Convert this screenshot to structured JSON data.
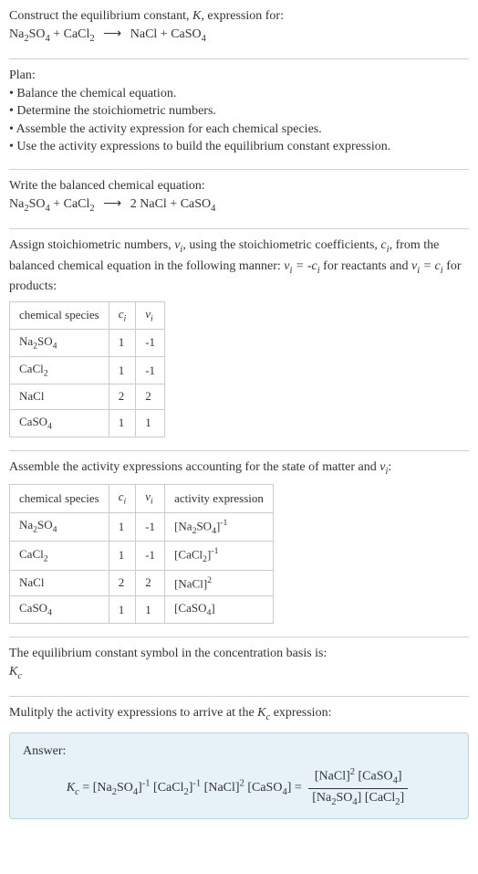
{
  "prompt": {
    "line1_pre": "Construct the equilibrium constant, ",
    "line1_post": ", expression for:"
  },
  "plan": {
    "heading": "Plan:",
    "items": [
      "Balance the chemical equation.",
      "Determine the stoichiometric numbers.",
      "Assemble the activity expression for each chemical species.",
      "Use the activity expressions to build the equilibrium constant expression."
    ]
  },
  "balanced_heading": "Write the balanced chemical equation:",
  "stoich_intro_pre": "Assign stoichiometric numbers, ",
  "stoich_intro_mid1": ", using the stoichiometric coefficients, ",
  "stoich_intro_mid2": ", from the balanced chemical equation in the following manner: ",
  "stoich_intro_mid3": " for reactants and ",
  "stoich_intro_post": " for products:",
  "table1": {
    "headers": [
      "chemical species",
      "cᵢ",
      "νᵢ"
    ],
    "rows": [
      [
        "Na₂SO₄",
        "1",
        "-1"
      ],
      [
        "CaCl₂",
        "1",
        "-1"
      ],
      [
        "NaCl",
        "2",
        "2"
      ],
      [
        "CaSO₄",
        "1",
        "1"
      ]
    ]
  },
  "activity_heading_pre": "Assemble the activity expressions accounting for the state of matter and ",
  "activity_heading_post": ":",
  "table2": {
    "headers": [
      "chemical species",
      "cᵢ",
      "νᵢ",
      "activity expression"
    ],
    "rows": [
      {
        "species": "Na₂SO₄",
        "c": "1",
        "nu": "-1",
        "expr": "[Na₂SO₄]",
        "pow": "-1"
      },
      {
        "species": "CaCl₂",
        "c": "1",
        "nu": "-1",
        "expr": "[CaCl₂]",
        "pow": "-1"
      },
      {
        "species": "NaCl",
        "c": "2",
        "nu": "2",
        "expr": "[NaCl]",
        "pow": "2"
      },
      {
        "species": "CaSO₄",
        "c": "1",
        "nu": "1",
        "expr": "[CaSO₄]",
        "pow": ""
      }
    ]
  },
  "kc_line": "The equilibrium constant symbol in the concentration basis is:",
  "multiply_line_pre": "Mulitply the activity expressions to arrive at the ",
  "multiply_line_post": " expression:",
  "answer_label": "Answer:",
  "chart_data": {
    "type": "table",
    "tables": [
      {
        "title": "Stoichiometric numbers",
        "headers": [
          "chemical species",
          "c_i",
          "nu_i"
        ],
        "rows": [
          [
            "Na2SO4",
            1,
            -1
          ],
          [
            "CaCl2",
            1,
            -1
          ],
          [
            "NaCl",
            2,
            2
          ],
          [
            "CaSO4",
            1,
            1
          ]
        ]
      },
      {
        "title": "Activity expressions",
        "headers": [
          "chemical species",
          "c_i",
          "nu_i",
          "activity expression"
        ],
        "rows": [
          [
            "Na2SO4",
            1,
            -1,
            "[Na2SO4]^-1"
          ],
          [
            "CaCl2",
            1,
            -1,
            "[CaCl2]^-1"
          ],
          [
            "NaCl",
            2,
            2,
            "[NaCl]^2"
          ],
          [
            "CaSO4",
            1,
            1,
            "[CaSO4]"
          ]
        ]
      }
    ],
    "unbalanced_equation": "Na2SO4 + CaCl2 -> NaCl + CaSO4",
    "balanced_equation": "Na2SO4 + CaCl2 -> 2 NaCl + CaSO4",
    "Kc_expression": "Kc = [Na2SO4]^-1 [CaCl2]^-1 [NaCl]^2 [CaSO4] = ([NaCl]^2 [CaSO4]) / ([Na2SO4] [CaCl2])"
  }
}
